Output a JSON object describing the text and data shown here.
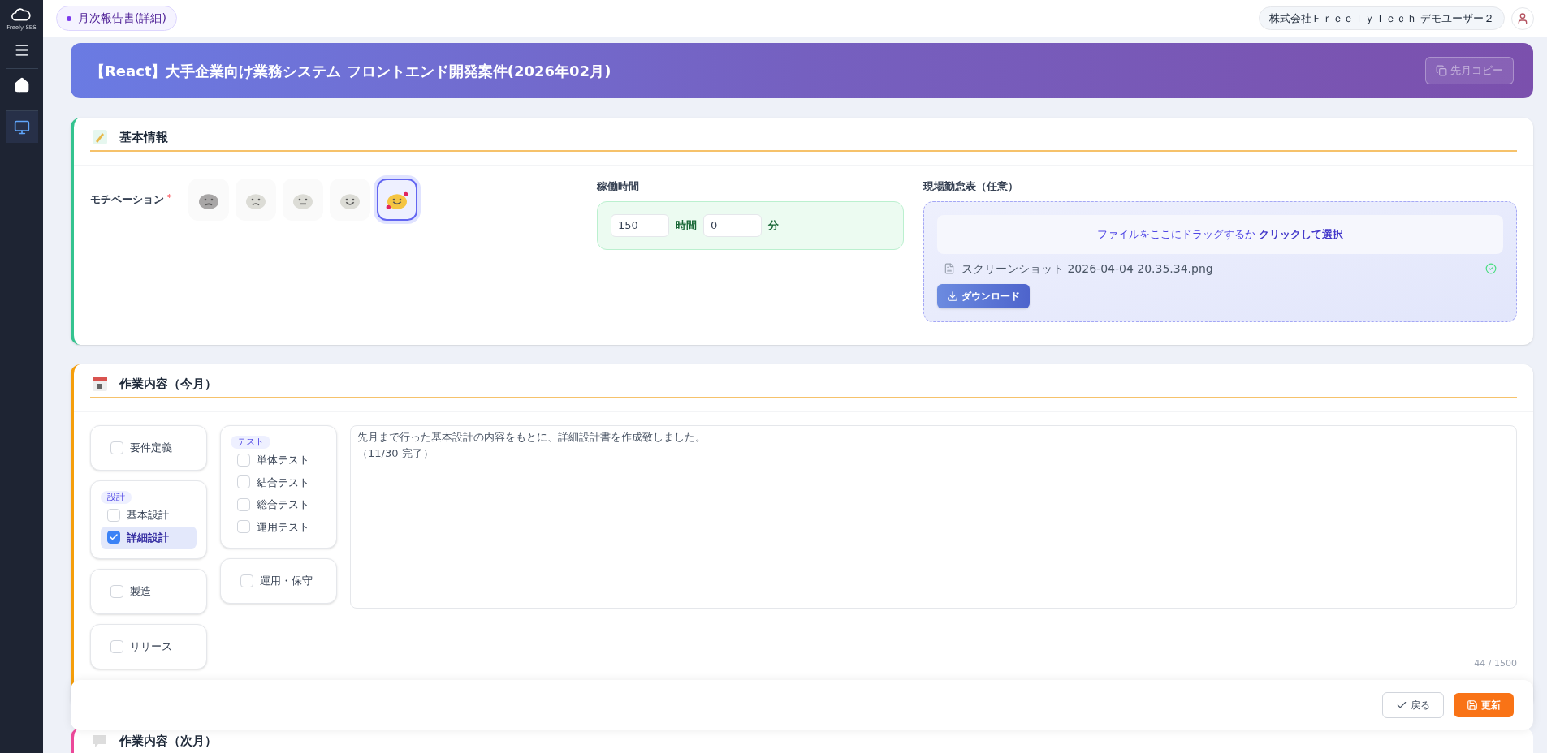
{
  "sidebar": {
    "logo_text": "Freely SES",
    "items": [
      {
        "kind": "home",
        "selected": false
      },
      {
        "kind": "monitor",
        "selected": true
      }
    ]
  },
  "topbar": {
    "page_badge": "月次報告書(詳細)",
    "user_name": "株式会社ＦｒｅｅｌｙＴｅｃｈ デモユーザー２"
  },
  "banner": {
    "title": "【React】大手企業向け業務システム フロントエンド開発案件(2026年02月)",
    "copy_button": {
      "label": "先月コピー",
      "disabled": true
    }
  },
  "basic_info": {
    "title": "基本情報",
    "motivation": {
      "label": "モチベーション",
      "required_mark": "*",
      "options": [
        {
          "kind": "very_bad",
          "selected": false
        },
        {
          "kind": "bad",
          "selected": false
        },
        {
          "kind": "neutral",
          "selected": false
        },
        {
          "kind": "good",
          "selected": false
        },
        {
          "kind": "great",
          "selected": true
        }
      ]
    },
    "work_hours": {
      "label": "稼働時間",
      "hours": "150",
      "hours_unit": "時間",
      "minutes": "0",
      "minutes_unit": "分"
    },
    "attendance": {
      "label": "現場勤怠表（任意）",
      "drop_text": "ファイルをここにドラッグするか",
      "drop_link": "クリックして選択",
      "file_name": "スクリーンショット 2026-04-04 20.35.34.png",
      "uploaded": true,
      "download_button": "ダウンロード"
    }
  },
  "work_this_month": {
    "title": "作業内容（今月）",
    "columns": [
      [
        {
          "kind": "single",
          "label": "要件定義",
          "checked": false
        },
        {
          "kind": "group",
          "title": "設計",
          "items": [
            {
              "label": "基本設計",
              "checked": false
            },
            {
              "label": "詳細設計",
              "checked": true
            }
          ]
        },
        {
          "kind": "single",
          "label": "製造",
          "checked": false
        },
        {
          "kind": "single",
          "label": "リリース",
          "checked": false
        }
      ],
      [
        {
          "kind": "group",
          "title": "テスト",
          "items": [
            {
              "label": "単体テスト",
              "checked": false
            },
            {
              "label": "結合テスト",
              "checked": false
            },
            {
              "label": "総合テスト",
              "checked": false
            },
            {
              "label": "運用テスト",
              "checked": false
            }
          ]
        },
        {
          "kind": "single",
          "label": "運用・保守",
          "checked": false
        }
      ]
    ],
    "description_lines": [
      "先月まで行った基本設計の内容をもとに、詳細設計書を作成致しました。",
      "（11/30 完了）"
    ],
    "char_count": "44 / 1500"
  },
  "work_next_month": {
    "title": "作業内容（次月）"
  },
  "footer": {
    "back_button": "戻る",
    "save_button": "更新"
  }
}
